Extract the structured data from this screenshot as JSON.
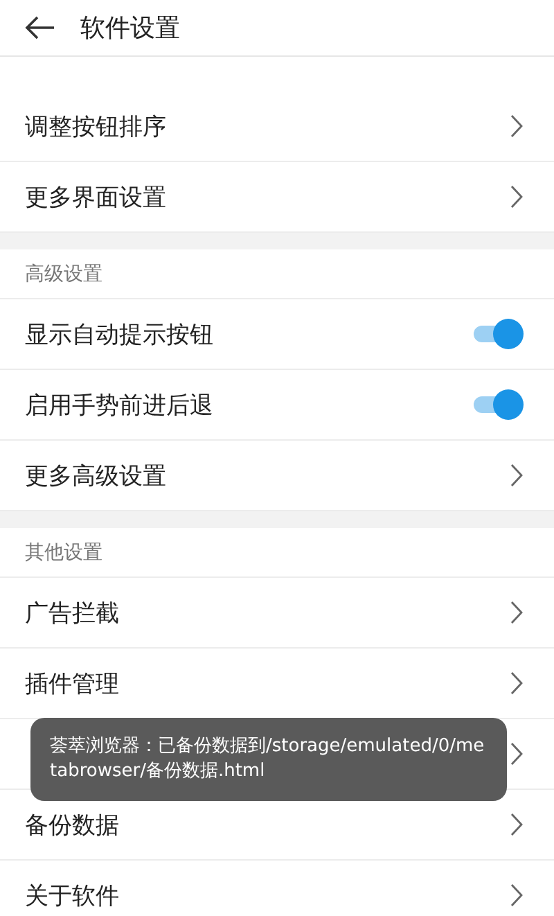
{
  "header": {
    "title": "软件设置"
  },
  "sections": [
    {
      "items": [
        {
          "kind": "link",
          "label": "调整按钮排序"
        },
        {
          "kind": "link",
          "label": "更多界面设置"
        }
      ]
    },
    {
      "title": "高级设置",
      "items": [
        {
          "kind": "toggle",
          "label": "显示自动提示按钮",
          "on": true
        },
        {
          "kind": "toggle",
          "label": "启用手势前进后退",
          "on": true
        },
        {
          "kind": "link",
          "label": "更多高级设置"
        }
      ]
    },
    {
      "title": "其他设置",
      "items": [
        {
          "kind": "link",
          "label": "广告拦截"
        },
        {
          "kind": "link",
          "label": "插件管理"
        },
        {
          "kind": "link"
        },
        {
          "kind": "link",
          "label": "备份数据"
        },
        {
          "kind": "link",
          "label": "关于软件"
        }
      ]
    }
  ],
  "toast": {
    "text": "荟萃浏览器：已备份数据到/storage/emulated/0/metabrowser/备份数据.html"
  }
}
